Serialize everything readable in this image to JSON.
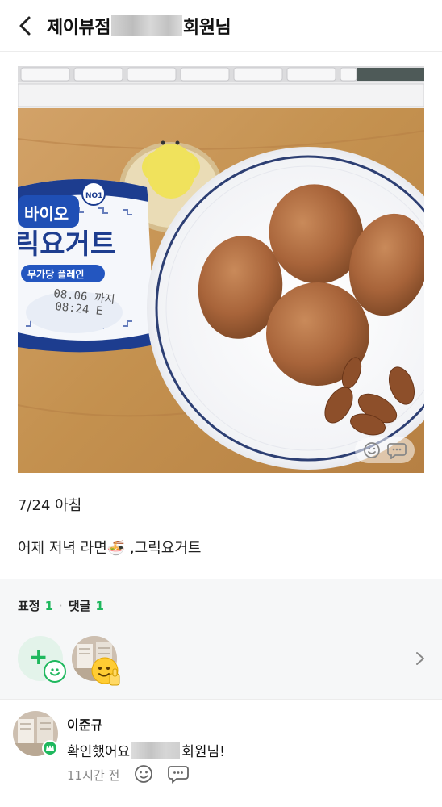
{
  "header": {
    "back_icon": "chevron-left-icon",
    "title_prefix": "제이뷰점",
    "title_suffix": "회원님"
  },
  "post": {
    "photo": {
      "yogurt_brand": "바이오",
      "yogurt_name": "릭요거트",
      "yogurt_sub": "무가당 플레인",
      "yogurt_date": "08.06 까지",
      "yogurt_time": "08:24 E"
    },
    "line1": "7/24 아침",
    "line2": "어제 저녁 라면🍜 ,그릭요거트"
  },
  "reactions": {
    "label_reactions": "표정",
    "count_reactions": "1",
    "label_comments": "댓글",
    "count_comments": "1"
  },
  "comment": {
    "author": "이준규",
    "text_prefix": "확인했어요",
    "text_suffix": "회원님!",
    "time": "11시간 전"
  },
  "colors": {
    "accent_green": "#1fb85e",
    "panel_bg": "#f6f7f8"
  }
}
